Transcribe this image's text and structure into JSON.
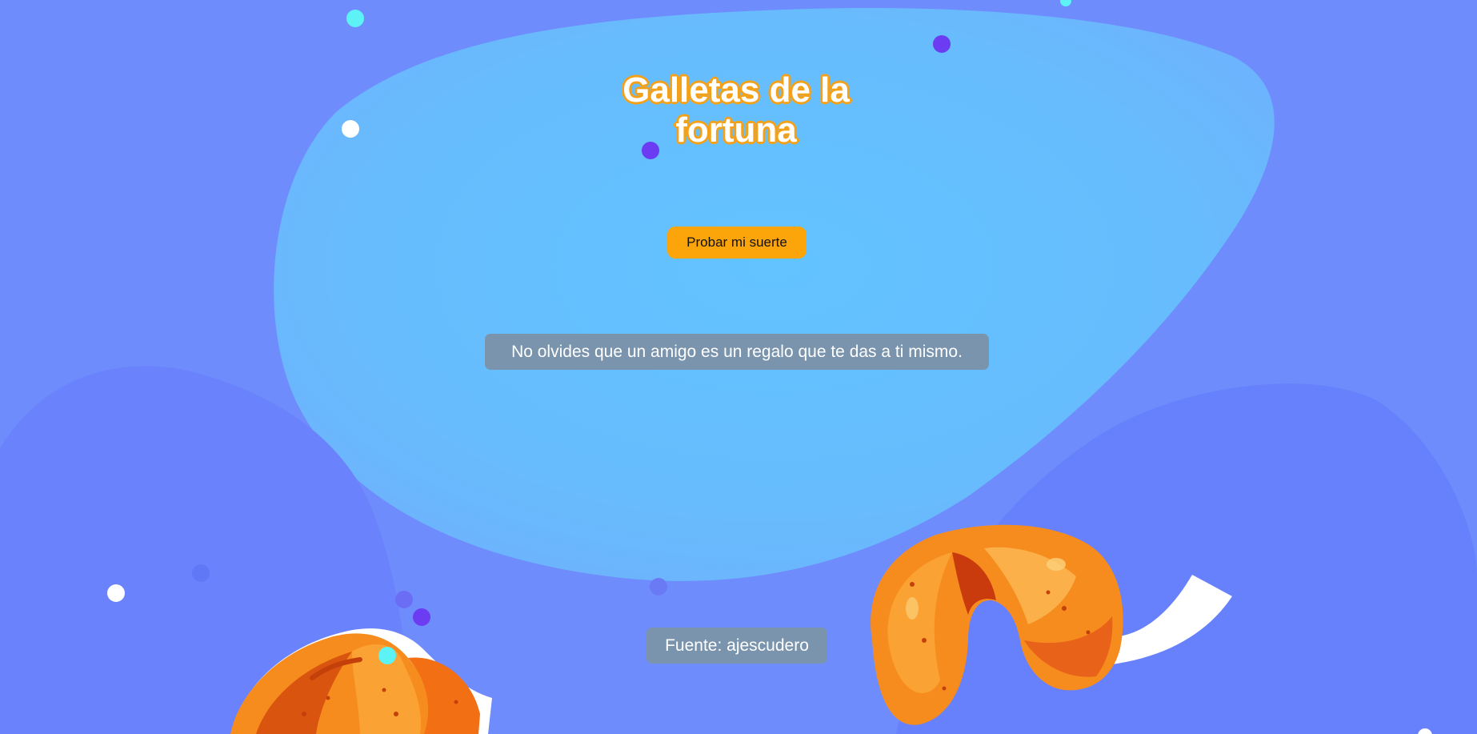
{
  "header": {
    "title_line1": "Galletas de la",
    "title_line2": "fortuna"
  },
  "actions": {
    "luck_button_label": "Probar mi suerte"
  },
  "fortune": {
    "message": "No olvides que un amigo es un regalo que te das a ti mismo."
  },
  "footer": {
    "source_text": "Fuente: ajescudero"
  },
  "colors": {
    "background": "#6f8cfc",
    "central_blob": "#64c0fe",
    "button": "#fca50a",
    "text_box": "#7a94ad",
    "title_outline": "#f4a11a",
    "cookie_orange": "#f78c1e"
  },
  "icons": {
    "left_cookie": "fortune-cookie-icon",
    "right_cookie": "fortune-cookie-open-icon"
  }
}
